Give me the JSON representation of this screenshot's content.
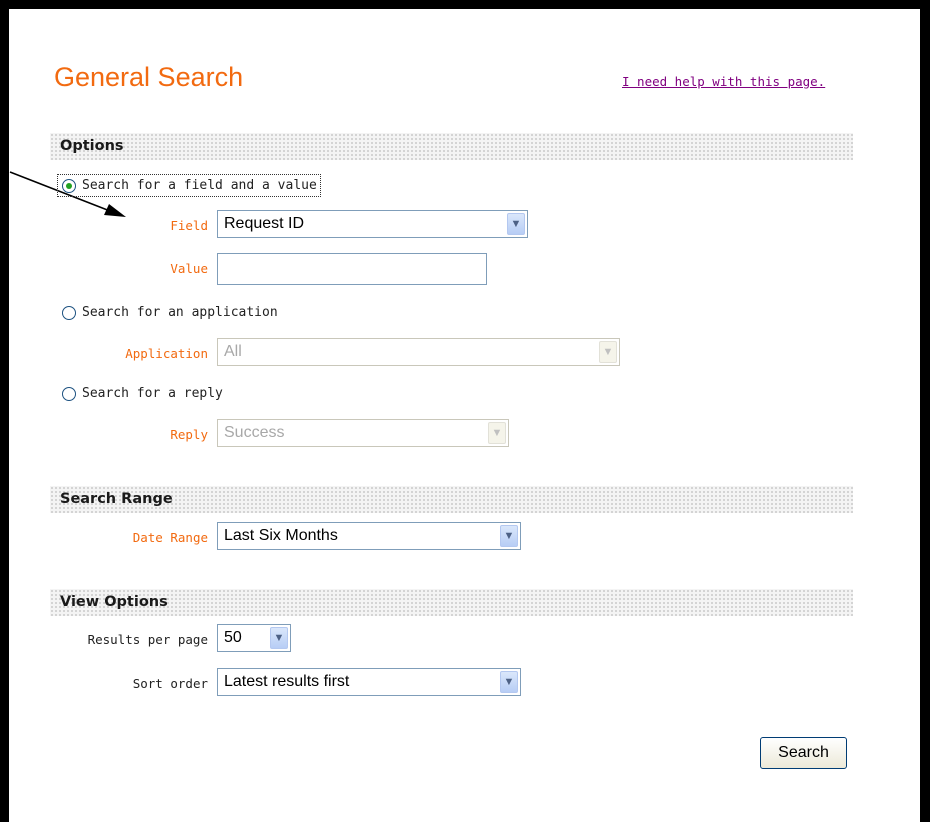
{
  "page": {
    "title": "General Search",
    "help_link": "I need help with this page."
  },
  "options": {
    "header": "Options",
    "search_field_value": {
      "label": "Search for a field and a value",
      "checked": true,
      "field_label": "Field",
      "field_value": "Request ID",
      "value_label": "Value",
      "value_text": ""
    },
    "search_application": {
      "label": "Search for an application",
      "checked": false,
      "application_label": "Application",
      "application_value": "All"
    },
    "search_reply": {
      "label": "Search for a reply",
      "checked": false,
      "reply_label": "Reply",
      "reply_value": "Success"
    }
  },
  "search_range": {
    "header": "Search Range",
    "date_range_label": "Date Range",
    "date_range_value": "Last Six Months"
  },
  "view_options": {
    "header": "View Options",
    "results_per_page_label": "Results per page",
    "results_per_page_value": "50",
    "sort_order_label": "Sort order",
    "sort_order_value": "Latest results first"
  },
  "actions": {
    "search_label": "Search"
  },
  "icons": {
    "dropdown": "chevron-down-icon",
    "annotation": "arrow-pointer"
  },
  "colors": {
    "accent": "#f26a10",
    "link": "#800080",
    "radio_checked": "#21a121",
    "input_border": "#7f9db9"
  }
}
